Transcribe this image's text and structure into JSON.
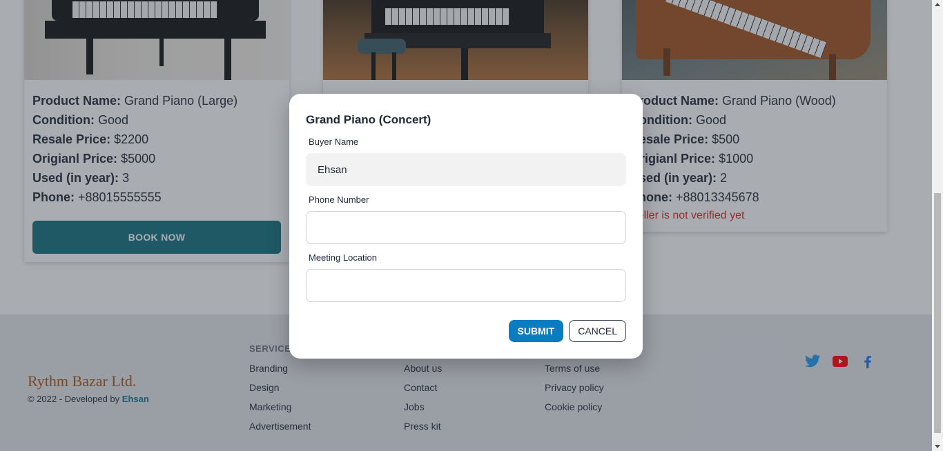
{
  "cards": [
    {
      "labels": {
        "name": "Product Name:",
        "condition": "Condition:",
        "resale": "Resale Price:",
        "original": "Origianl Price:",
        "used": "Used (in year):",
        "phone": "Phone:"
      },
      "name": "Grand Piano (Large)",
      "condition": "Good",
      "resale": "$2200",
      "original": "$5000",
      "used": "3",
      "phone": "+88015555555",
      "book_label": "BOOK NOW"
    },
    {
      "labels": {
        "name": "Product Name:",
        "condition": "Condition:",
        "resale": "Resale Price:",
        "original": "Origianl Price:",
        "used": "Used (in year):",
        "phone": "Phone:"
      },
      "name": "Grand Piano (Wood)",
      "condition": "Good",
      "resale": "$500",
      "original": "$1000",
      "used": "2",
      "phone": "+88013345678",
      "warning": "Seller is not verified yet"
    }
  ],
  "modal": {
    "title": "Grand Piano (Concert)",
    "buyer_label": "Buyer Name",
    "buyer_value": "Ehsan",
    "phone_label": "Phone Number",
    "location_label": "Meeting Location",
    "submit": "SUBMIT",
    "cancel": "CANCEL"
  },
  "footer": {
    "brand": "Rythm Bazar Ltd.",
    "copyright_prefix": "© 2022 - Developed by",
    "developer": "Ehsan",
    "services_title": "SERVICES",
    "services": [
      "Branding",
      "Design",
      "Marketing",
      "Advertisement"
    ],
    "company": [
      "About us",
      "Contact",
      "Jobs",
      "Press kit"
    ],
    "legal": [
      "Terms of use",
      "Privacy policy",
      "Cookie policy"
    ],
    "social": [
      "twitter-icon",
      "youtube-icon",
      "facebook-icon"
    ]
  },
  "colors": {
    "accent": "#12707e",
    "submit": "#0a7cc1",
    "brand": "#b45309",
    "warning": "#dc2626"
  }
}
